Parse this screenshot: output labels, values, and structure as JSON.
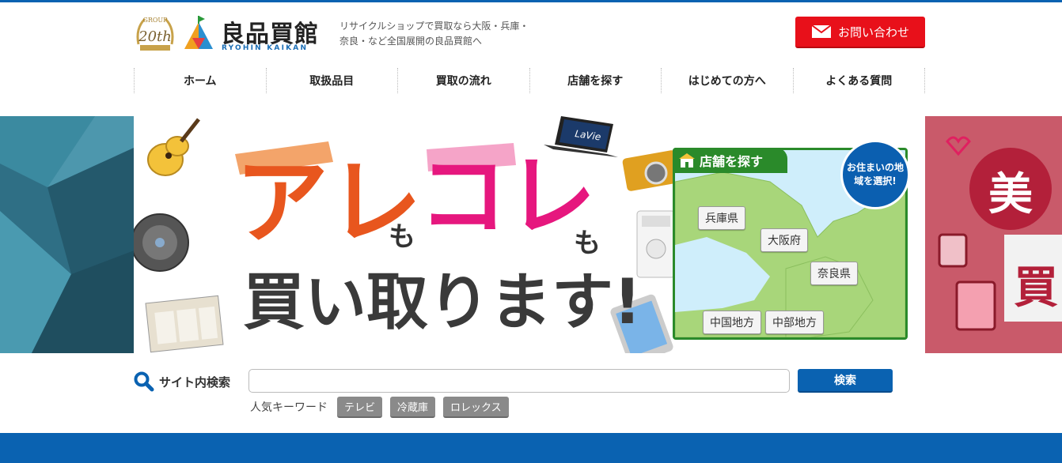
{
  "header": {
    "badge_top": "GROUP",
    "badge_num": "20th",
    "logo_text": "良品買館",
    "logo_sub": "RYOHIN KAIKAN",
    "tagline": "リサイクルショップで買取なら大阪・兵庫・奈良・など全国展開の良品買館へ",
    "contact_label": "お問い合わせ"
  },
  "nav": [
    "ホーム",
    "取扱品目",
    "買取の流れ",
    "店舗を探す",
    "はじめての方へ",
    "よくある質問"
  ],
  "hero": {
    "headline_a": "アレ",
    "headline_mo1": "も",
    "headline_b": "コレ",
    "headline_mo2": "も",
    "headline_2": "買い取ります!",
    "laptop_brand": "LaVie",
    "right_side_1": "美",
    "right_side_2": "買"
  },
  "store_map": {
    "tab_label": "店舗を探す",
    "bubble_text": "お住まいの地域を選択!",
    "prefectures": [
      "兵庫県",
      "大阪府",
      "奈良県",
      "中国地方",
      "中部地方"
    ]
  },
  "search": {
    "label": "サイト内検索",
    "placeholder": "",
    "button": "検索",
    "keywords_label": "人気キーワード",
    "keywords": [
      "テレビ",
      "冷蔵庫",
      "ロレックス"
    ]
  },
  "colors": {
    "brand_blue": "#0a62b1",
    "contact_red": "#e8101a",
    "map_green": "#2a8a2a"
  }
}
